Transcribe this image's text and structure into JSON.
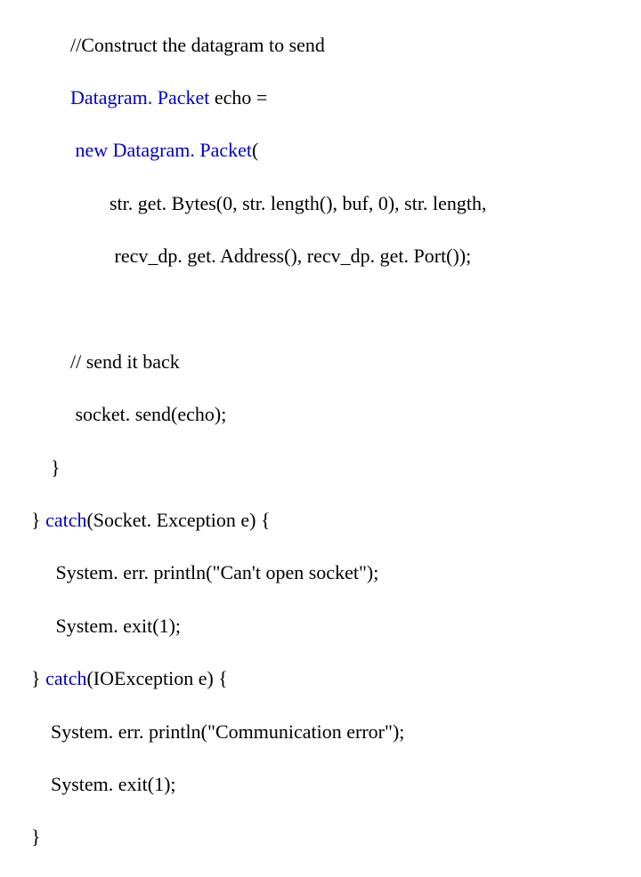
{
  "code": {
    "l1_comment": "//Construct the datagram to send",
    "l2_type": "Datagram. Packet",
    "l2_rest": " echo =",
    "l3_new": " new ",
    "l3_type": "Datagram. Packet",
    "l3_open": "(",
    "l4": "str. get. Bytes(0, str. length(), buf, 0), str. length,",
    "l5": " recv_dp. get. Address(), recv_dp. get. Port());",
    "l6_comment": "// send it back",
    "l7": " socket. send(echo);",
    "l8": "}",
    "l9_a": "} ",
    "l9_catch": "catch",
    "l9_b": "(Socket. Exception e) {",
    "l10": "System. err. println(\"Can't open socket\");",
    "l11": "System. exit(1);",
    "l12_a": "} ",
    "l12_catch": "catch",
    "l12_b": "(IOException e) {",
    "l13": "System. err. println(\"Communication error\");",
    "l14": "System. exit(1);",
    "l15": "}"
  }
}
